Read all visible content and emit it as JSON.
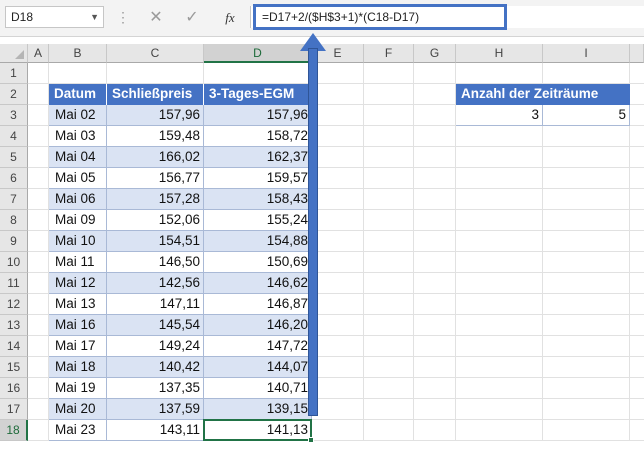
{
  "formula_bar": {
    "name_box": "D18",
    "cancel_icon": "✕",
    "enter_icon": "✓",
    "fx_label": "fx",
    "formula": "=D17+2/($H$3+1)*(C18-D17)"
  },
  "columns": [
    "A",
    "B",
    "C",
    "D",
    "E",
    "F",
    "G",
    "H",
    "I"
  ],
  "rows": [
    "1",
    "2",
    "3",
    "4",
    "5",
    "6",
    "7",
    "8",
    "9",
    "10",
    "11",
    "12",
    "13",
    "14",
    "15",
    "16",
    "17",
    "18"
  ],
  "table": {
    "headers": [
      "Datum",
      "Schließpreis",
      "3-Tages-EGM"
    ],
    "rows": [
      [
        "Mai 02",
        "157,96",
        "157,96"
      ],
      [
        "Mai 03",
        "159,48",
        "158,72"
      ],
      [
        "Mai 04",
        "166,02",
        "162,37"
      ],
      [
        "Mai 05",
        "156,77",
        "159,57"
      ],
      [
        "Mai 06",
        "157,28",
        "158,43"
      ],
      [
        "Mai 09",
        "152,06",
        "155,24"
      ],
      [
        "Mai 10",
        "154,51",
        "154,88"
      ],
      [
        "Mai 11",
        "146,50",
        "150,69"
      ],
      [
        "Mai 12",
        "142,56",
        "146,62"
      ],
      [
        "Mai 13",
        "147,11",
        "146,87"
      ],
      [
        "Mai 16",
        "145,54",
        "146,20"
      ],
      [
        "Mai 17",
        "149,24",
        "147,72"
      ],
      [
        "Mai 18",
        "140,42",
        "144,07"
      ],
      [
        "Mai 19",
        "137,35",
        "140,71"
      ],
      [
        "Mai 20",
        "137,59",
        "139,15"
      ],
      [
        "Mai 23",
        "143,11",
        "141,13"
      ]
    ]
  },
  "periods": {
    "header": "Anzahl der Zeiträume",
    "h_value": "3",
    "i_value": "5"
  },
  "colors": {
    "header_fill": "#4472c4",
    "band_fill": "#dae3f3",
    "selection": "#217346",
    "arrow": "#4472c4"
  }
}
